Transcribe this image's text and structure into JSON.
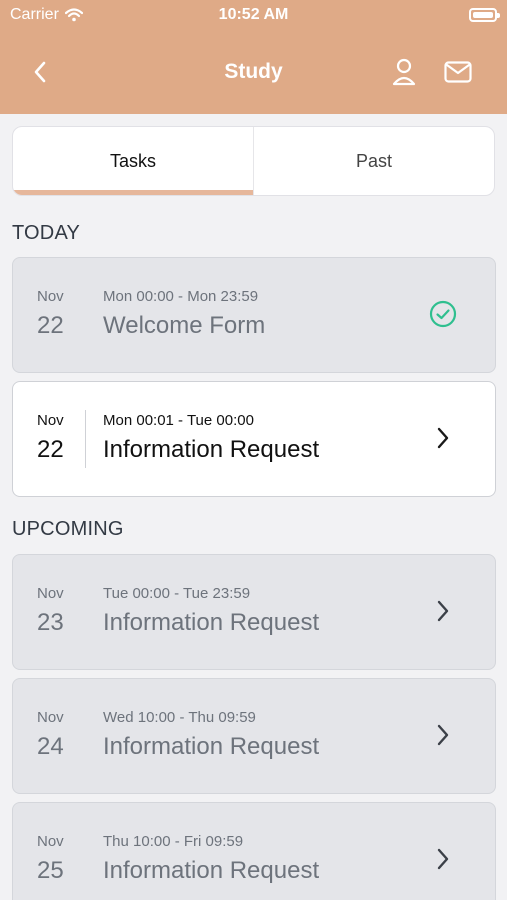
{
  "status_bar": {
    "carrier": "Carrier",
    "time": "10:52 AM"
  },
  "navbar": {
    "title": "Study"
  },
  "tabs": [
    {
      "label": "Tasks",
      "active": true
    },
    {
      "label": "Past",
      "active": false
    }
  ],
  "sections": {
    "today": "TODAY",
    "upcoming": "UPCOMING"
  },
  "today_tasks": [
    {
      "month": "Nov",
      "day": "22",
      "time_range": "Mon 00:00 - Mon 23:59",
      "title": "Welcome Form",
      "status": "completed",
      "icon": "check-circle-icon"
    },
    {
      "month": "Nov",
      "day": "22",
      "time_range": "Mon 00:01 - Tue 00:00",
      "title": "Information Request",
      "status": "available",
      "icon": "chevron-right-icon"
    }
  ],
  "upcoming_tasks": [
    {
      "month": "Nov",
      "day": "23",
      "time_range": "Tue 00:00 - Tue 23:59",
      "title": "Information Request",
      "status": "upcoming",
      "icon": "chevron-right-icon"
    },
    {
      "month": "Nov",
      "day": "24",
      "time_range": "Wed 10:00 - Thu 09:59",
      "title": "Information Request",
      "status": "upcoming",
      "icon": "chevron-right-icon"
    },
    {
      "month": "Nov",
      "day": "25",
      "time_range": "Thu 10:00 - Fri 09:59",
      "title": "Information Request",
      "status": "upcoming",
      "icon": "chevron-right-icon"
    }
  ],
  "colors": {
    "header": "#dfaa87",
    "tab_indicator": "#e6b79b",
    "check": "#2fbf8f",
    "muted_card": "#e4e5e9"
  }
}
